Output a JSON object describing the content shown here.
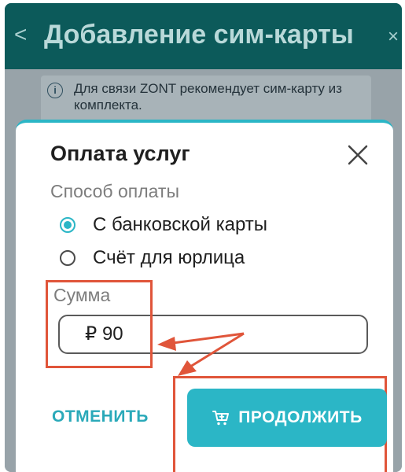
{
  "header": {
    "back_icon": "chevron-left-icon",
    "title": "Добавление сим-карты",
    "close_icon": "close-icon"
  },
  "info": {
    "icon": "info-icon",
    "text": "Для связи ZONT рекомендует сим-карту из комплекта."
  },
  "dialog": {
    "title": "Оплата услуг",
    "close_icon": "close-icon",
    "payment_method_label": "Способ оплаты",
    "payment_options": [
      {
        "label": "С банковской карты",
        "selected": true
      },
      {
        "label": "Счёт для юрлица",
        "selected": false
      }
    ],
    "amount_label": "Сумма",
    "amount_value": "₽ 90",
    "cancel_label": "ОТМЕНИТЬ",
    "continue_label": "ПРОДОЛЖИТЬ",
    "continue_icon": "cart-icon"
  },
  "colors": {
    "accent": "#2bb6c6",
    "header_bg": "#0c5a5a",
    "annotation": "#e0553a"
  }
}
